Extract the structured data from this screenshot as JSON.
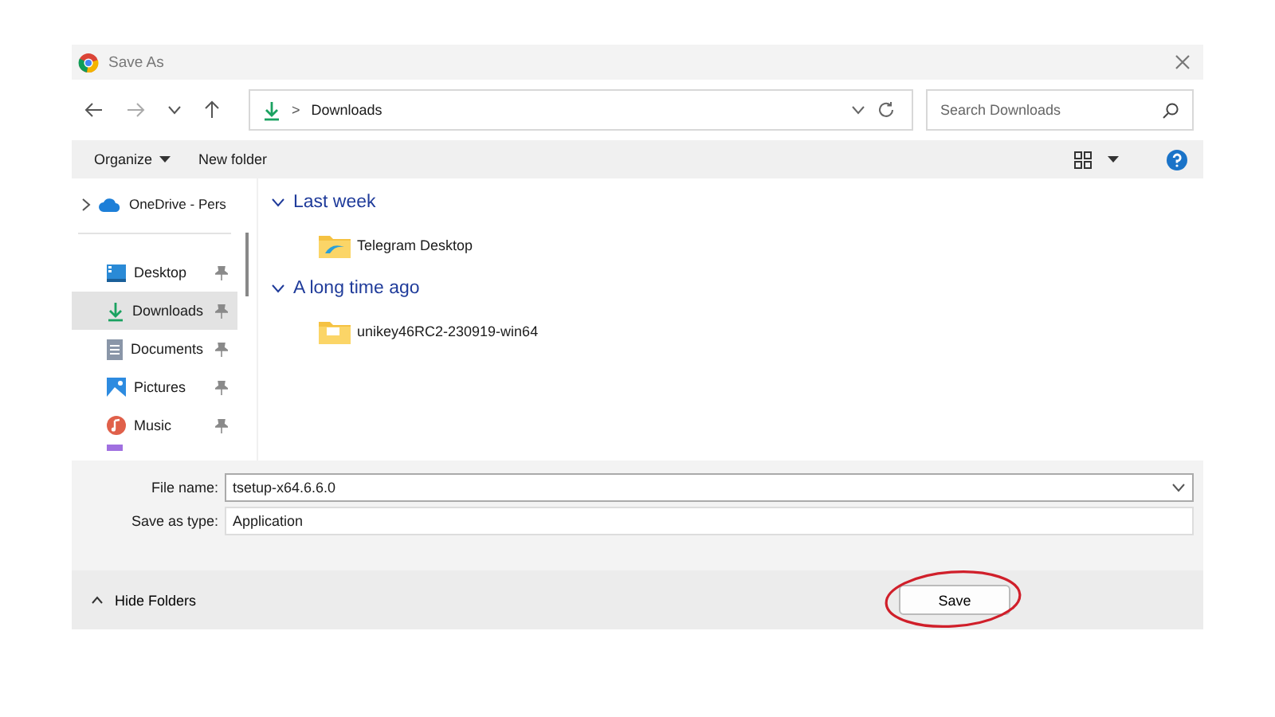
{
  "window": {
    "title": "Save As"
  },
  "address": {
    "location": "Downloads",
    "separator": ">"
  },
  "search": {
    "placeholder": "Search Downloads"
  },
  "command_bar": {
    "organize": "Organize",
    "new_folder": "New folder"
  },
  "sidebar": {
    "top": {
      "label": "OneDrive - Pers",
      "expanded": false
    },
    "items": [
      {
        "label": "Desktop",
        "kind": "desktop",
        "selected": false,
        "pinned": true
      },
      {
        "label": "Downloads",
        "kind": "downloads",
        "selected": true,
        "pinned": true
      },
      {
        "label": "Documents",
        "kind": "documents",
        "selected": false,
        "pinned": true
      },
      {
        "label": "Pictures",
        "kind": "pictures",
        "selected": false,
        "pinned": true
      },
      {
        "label": "Music",
        "kind": "music",
        "selected": false,
        "pinned": true
      }
    ]
  },
  "groups": [
    {
      "title": "Last week",
      "expanded": true,
      "items": [
        {
          "name": "Telegram Desktop",
          "kind": "app-folder"
        }
      ]
    },
    {
      "title": "A long time ago",
      "expanded": true,
      "items": [
        {
          "name": "unikey46RC2-230919-win64",
          "kind": "folder"
        }
      ]
    }
  ],
  "form": {
    "file_name_label": "File name:",
    "file_name": "tsetup-x64.6.6.0",
    "type_label": "Save as type:",
    "type": "Application"
  },
  "footer": {
    "hide_folders": "Hide Folders",
    "save": "Save",
    "save_highlighted": true
  }
}
